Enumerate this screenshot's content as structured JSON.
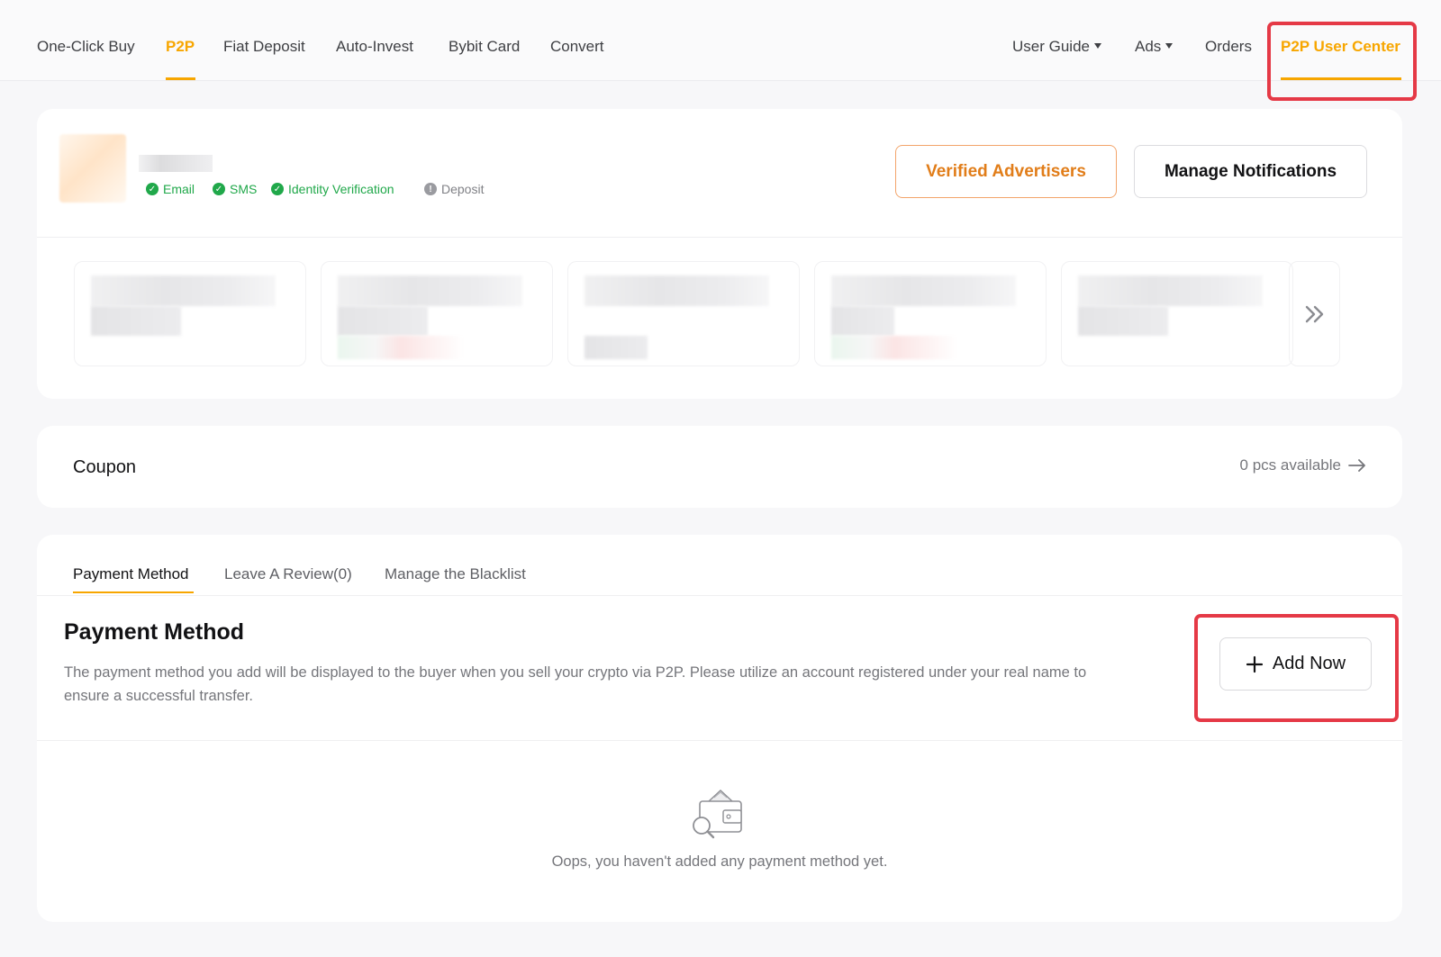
{
  "nav": {
    "left": [
      "One-Click Buy",
      "P2P",
      "Fiat Deposit",
      "Auto-Invest",
      "Bybit Card",
      "Convert"
    ],
    "user_guide": "User Guide",
    "ads": "Ads",
    "orders": "Orders",
    "user_center": "P2P User Center"
  },
  "colors": {
    "accent": "#f7a600",
    "highlight": "#e53946",
    "verified": "#20a84a"
  },
  "profile": {
    "badges": [
      {
        "label": "Email",
        "status": "verified"
      },
      {
        "label": "SMS",
        "status": "verified"
      },
      {
        "label": "Identity Verification",
        "status": "verified"
      },
      {
        "label": "Deposit",
        "status": "pending"
      }
    ],
    "verified_advertisers": "Verified Advertisers",
    "manage_notifications": "Manage Notifications"
  },
  "coupon": {
    "title": "Coupon",
    "available": "0 pcs available"
  },
  "tabs": [
    "Payment Method",
    "Leave A Review(0)",
    "Manage the Blacklist"
  ],
  "payment": {
    "title": "Payment Method",
    "description": "The payment method you add will be displayed to the buyer when you sell your crypto via P2P. Please utilize an account registered under your real name to ensure a successful transfer.",
    "add_button": "Add Now",
    "empty_text": "Oops, you haven't added any payment method yet."
  }
}
